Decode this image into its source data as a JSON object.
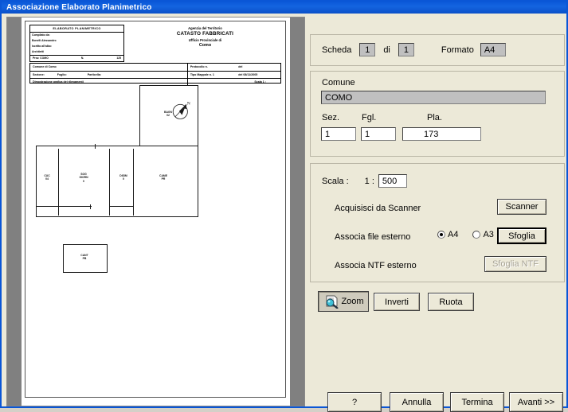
{
  "window": {
    "title": "Associazione Elaborato Planimetrico"
  },
  "panel": {
    "scheda": {
      "label": "Scheda",
      "current": "1",
      "di_label": "di",
      "total": "1",
      "formato_label": "Formato",
      "formato_value": "A4"
    },
    "comune": {
      "label": "Comune",
      "value": "COMO",
      "sez_label": "Sez.",
      "sez_value": "1",
      "fgl_label": "Fgl.",
      "fgl_value": "1",
      "pla_label": "Pla.",
      "pla_value": "173"
    },
    "scala": {
      "label": "Scala :",
      "prefix": "1 :",
      "value": "500",
      "scanner_label": "Acquisisci da Scanner",
      "scanner_button": "Scanner",
      "file_label": "Associa file esterno",
      "radio_a4": "A4",
      "radio_a3": "A3",
      "selected_format": "A4",
      "sfoglia_button": "Sfoglia",
      "ntf_label": "Associa NTF esterno",
      "sfoglia_ntf_button": "Sfoglia NTF"
    },
    "tools": {
      "zoom": "Zoom",
      "inverti": "Inverti",
      "ruota": "Ruota"
    },
    "footer": {
      "help": "?",
      "annulla": "Annulla",
      "termina": "Termina",
      "avanti": "Avanti >>"
    }
  },
  "document": {
    "titleblock": {
      "heading": "ELABORATO PLANIMETRICO",
      "r1a": "Compilato da:",
      "r1b": "Bonelli Alessandro",
      "r2a": "Iscritto all'albo:",
      "r2b": "Architetti",
      "r3a": "Prov. COMO",
      "r3b": "N.",
      "r3c": "125"
    },
    "agency": {
      "line1": "Agenzia del Territorio",
      "line2": "CATASTO FABBRICATI",
      "line3": "Ufficio Provinciale di",
      "line4": "Como"
    },
    "table": {
      "comune": "Comune di Como",
      "sezione": "Sezione:",
      "foglio": "Foglio:",
      "particella": "Particella:",
      "dimostrazione": "Dimostrazione grafica dei rilevamenti",
      "protocollo": "Protocollo n.",
      "protocollo_del": "del",
      "tipo_mappale": "Tipo Mappale n. 1",
      "tipo_mappale_del": "del 08/11/2005",
      "scala": "Scala 1 :"
    },
    "rooms": [
      {
        "name": "BAGN",
        "sub": "02"
      },
      {
        "name": "CUC",
        "sub": "04"
      },
      {
        "name": "SOG",
        "sub": "GIORN",
        "extra": "0"
      },
      {
        "name": "DISIM",
        "sub": "0"
      },
      {
        "name": "CAME",
        "sub": "PR"
      },
      {
        "name": "CANT",
        "sub": "PB"
      }
    ],
    "compass": {
      "label": "N"
    }
  }
}
